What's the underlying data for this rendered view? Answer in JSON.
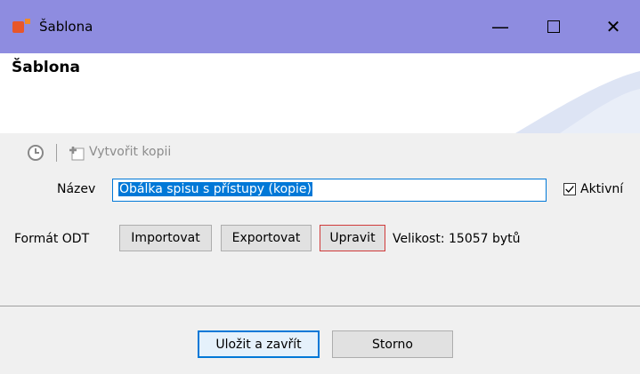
{
  "window": {
    "title": "Šablona"
  },
  "banner": {
    "title": "Šablona"
  },
  "toolbar": {
    "copy_label": "Vytvořit kopii"
  },
  "form": {
    "name_label": "Název",
    "name_value": "Obálka spisu s přístupy (kopie)",
    "active_label": "Aktivní",
    "active_checked": true,
    "format_label": "Formát ODT",
    "import_label": "Importovat",
    "export_label": "Exportovat",
    "edit_label": "Upravit",
    "size_text": "Velikost: 15057 bytů"
  },
  "footer": {
    "save_close_label": "Uložit a zavřít",
    "cancel_label": "Storno"
  },
  "colors": {
    "titlebar": "#8e8ce0",
    "accent": "#0078d7",
    "edit_border": "#d03a3a"
  }
}
